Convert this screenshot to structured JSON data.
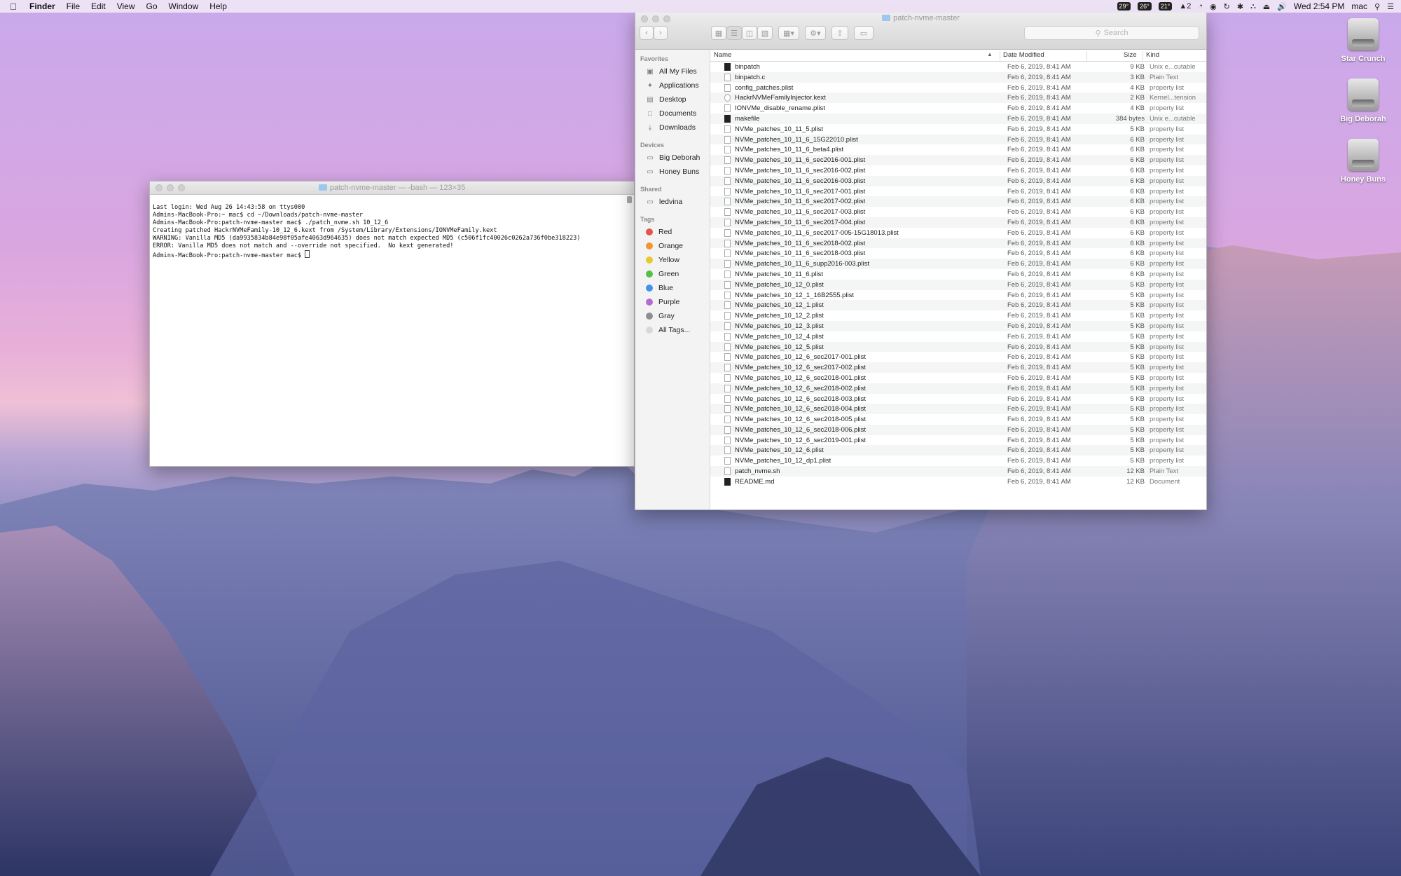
{
  "menubar": {
    "app": "Finder",
    "items": [
      "File",
      "Edit",
      "View",
      "Go",
      "Window",
      "Help"
    ],
    "status": {
      "temp1": "29°",
      "temp2": "26°",
      "temp3": "21°",
      "notif": "2",
      "clock": "Wed 2:54 PM",
      "user": "mac"
    }
  },
  "desktop_icons": [
    {
      "label": "Star Crunch"
    },
    {
      "label": "Big Deborah"
    },
    {
      "label": "Honey Buns"
    }
  ],
  "terminal": {
    "title": "patch-nvme-master — -bash — 123×35",
    "lines": [
      "Last login: Wed Aug 26 14:43:58 on ttys000",
      "Admins-MacBook-Pro:~ mac$ cd ~/Downloads/patch-nvme-master",
      "Admins-MacBook-Pro:patch-nvme-master mac$ ./patch_nvme.sh 10_12_6",
      "Creating patched HackrNVMeFamily-10_12_6.kext from /System/Library/Extensions/IONVMeFamily.kext",
      "WARNING: Vanilla MD5 (da9935834b84e98f05afe4063d964635) does not match expected MD5 (c506f1fc40026c0262a736f0be318223)",
      "ERROR: Vanilla MD5 does not match and --override not specified.  No kext generated!",
      "Admins-MacBook-Pro:patch-nvme-master mac$ "
    ]
  },
  "finder": {
    "title": "patch-nvme-master",
    "search_placeholder": "Search",
    "sidebar": {
      "favorites_header": "Favorites",
      "favorites": [
        "All My Files",
        "Applications",
        "Desktop",
        "Documents",
        "Downloads"
      ],
      "devices_header": "Devices",
      "devices": [
        "Big Deborah",
        "Honey Buns"
      ],
      "shared_header": "Shared",
      "shared": [
        "ledvina"
      ],
      "tags_header": "Tags",
      "tags": [
        {
          "name": "Red",
          "color": "#e5534b"
        },
        {
          "name": "Orange",
          "color": "#f0962f"
        },
        {
          "name": "Yellow",
          "color": "#e9c72e"
        },
        {
          "name": "Green",
          "color": "#55c046"
        },
        {
          "name": "Blue",
          "color": "#3f94e9"
        },
        {
          "name": "Purple",
          "color": "#b66bd3"
        },
        {
          "name": "Gray",
          "color": "#8e8e93"
        },
        {
          "name": "All Tags...",
          "color": "#d8d8d8"
        }
      ]
    },
    "columns": {
      "name": "Name",
      "date": "Date Modified",
      "size": "Size",
      "kind": "Kind"
    },
    "files": [
      {
        "name": "binpatch",
        "date": "Feb 6, 2019, 8:41 AM",
        "size": "9 KB",
        "kind": "Unix e...cutable",
        "type": "exec"
      },
      {
        "name": "binpatch.c",
        "date": "Feb 6, 2019, 8:41 AM",
        "size": "3 KB",
        "kind": "Plain Text",
        "type": "doc"
      },
      {
        "name": "config_patches.plist",
        "date": "Feb 6, 2019, 8:41 AM",
        "size": "4 KB",
        "kind": "property list",
        "type": "doc"
      },
      {
        "name": "HackrNVMeFamilyInjector.kext",
        "date": "Feb 6, 2019, 8:41 AM",
        "size": "2 KB",
        "kind": "Kernel...tension",
        "type": "kext"
      },
      {
        "name": "IONVMe_disable_rename.plist",
        "date": "Feb 6, 2019, 8:41 AM",
        "size": "4 KB",
        "kind": "property list",
        "type": "doc"
      },
      {
        "name": "makefile",
        "date": "Feb 6, 2019, 8:41 AM",
        "size": "384 bytes",
        "kind": "Unix e...cutable",
        "type": "exec"
      },
      {
        "name": "NVMe_patches_10_11_5.plist",
        "date": "Feb 6, 2019, 8:41 AM",
        "size": "5 KB",
        "kind": "property list",
        "type": "doc"
      },
      {
        "name": "NVMe_patches_10_11_6_15G22010.plist",
        "date": "Feb 6, 2019, 8:41 AM",
        "size": "6 KB",
        "kind": "property list",
        "type": "doc"
      },
      {
        "name": "NVMe_patches_10_11_6_beta4.plist",
        "date": "Feb 6, 2019, 8:41 AM",
        "size": "6 KB",
        "kind": "property list",
        "type": "doc"
      },
      {
        "name": "NVMe_patches_10_11_6_sec2016-001.plist",
        "date": "Feb 6, 2019, 8:41 AM",
        "size": "6 KB",
        "kind": "property list",
        "type": "doc"
      },
      {
        "name": "NVMe_patches_10_11_6_sec2016-002.plist",
        "date": "Feb 6, 2019, 8:41 AM",
        "size": "6 KB",
        "kind": "property list",
        "type": "doc"
      },
      {
        "name": "NVMe_patches_10_11_6_sec2016-003.plist",
        "date": "Feb 6, 2019, 8:41 AM",
        "size": "6 KB",
        "kind": "property list",
        "type": "doc"
      },
      {
        "name": "NVMe_patches_10_11_6_sec2017-001.plist",
        "date": "Feb 6, 2019, 8:41 AM",
        "size": "6 KB",
        "kind": "property list",
        "type": "doc"
      },
      {
        "name": "NVMe_patches_10_11_6_sec2017-002.plist",
        "date": "Feb 6, 2019, 8:41 AM",
        "size": "6 KB",
        "kind": "property list",
        "type": "doc"
      },
      {
        "name": "NVMe_patches_10_11_6_sec2017-003.plist",
        "date": "Feb 6, 2019, 8:41 AM",
        "size": "6 KB",
        "kind": "property list",
        "type": "doc"
      },
      {
        "name": "NVMe_patches_10_11_6_sec2017-004.plist",
        "date": "Feb 6, 2019, 8:41 AM",
        "size": "6 KB",
        "kind": "property list",
        "type": "doc"
      },
      {
        "name": "NVMe_patches_10_11_6_sec2017-005-15G18013.plist",
        "date": "Feb 6, 2019, 8:41 AM",
        "size": "6 KB",
        "kind": "property list",
        "type": "doc"
      },
      {
        "name": "NVMe_patches_10_11_6_sec2018-002.plist",
        "date": "Feb 6, 2019, 8:41 AM",
        "size": "6 KB",
        "kind": "property list",
        "type": "doc"
      },
      {
        "name": "NVMe_patches_10_11_6_sec2018-003.plist",
        "date": "Feb 6, 2019, 8:41 AM",
        "size": "6 KB",
        "kind": "property list",
        "type": "doc"
      },
      {
        "name": "NVMe_patches_10_11_6_supp2016-003.plist",
        "date": "Feb 6, 2019, 8:41 AM",
        "size": "6 KB",
        "kind": "property list",
        "type": "doc"
      },
      {
        "name": "NVMe_patches_10_11_6.plist",
        "date": "Feb 6, 2019, 8:41 AM",
        "size": "6 KB",
        "kind": "property list",
        "type": "doc"
      },
      {
        "name": "NVMe_patches_10_12_0.plist",
        "date": "Feb 6, 2019, 8:41 AM",
        "size": "5 KB",
        "kind": "property list",
        "type": "doc"
      },
      {
        "name": "NVMe_patches_10_12_1_16B2555.plist",
        "date": "Feb 6, 2019, 8:41 AM",
        "size": "5 KB",
        "kind": "property list",
        "type": "doc"
      },
      {
        "name": "NVMe_patches_10_12_1.plist",
        "date": "Feb 6, 2019, 8:41 AM",
        "size": "5 KB",
        "kind": "property list",
        "type": "doc"
      },
      {
        "name": "NVMe_patches_10_12_2.plist",
        "date": "Feb 6, 2019, 8:41 AM",
        "size": "5 KB",
        "kind": "property list",
        "type": "doc"
      },
      {
        "name": "NVMe_patches_10_12_3.plist",
        "date": "Feb 6, 2019, 8:41 AM",
        "size": "5 KB",
        "kind": "property list",
        "type": "doc"
      },
      {
        "name": "NVMe_patches_10_12_4.plist",
        "date": "Feb 6, 2019, 8:41 AM",
        "size": "5 KB",
        "kind": "property list",
        "type": "doc"
      },
      {
        "name": "NVMe_patches_10_12_5.plist",
        "date": "Feb 6, 2019, 8:41 AM",
        "size": "5 KB",
        "kind": "property list",
        "type": "doc"
      },
      {
        "name": "NVMe_patches_10_12_6_sec2017-001.plist",
        "date": "Feb 6, 2019, 8:41 AM",
        "size": "5 KB",
        "kind": "property list",
        "type": "doc"
      },
      {
        "name": "NVMe_patches_10_12_6_sec2017-002.plist",
        "date": "Feb 6, 2019, 8:41 AM",
        "size": "5 KB",
        "kind": "property list",
        "type": "doc"
      },
      {
        "name": "NVMe_patches_10_12_6_sec2018-001.plist",
        "date": "Feb 6, 2019, 8:41 AM",
        "size": "5 KB",
        "kind": "property list",
        "type": "doc"
      },
      {
        "name": "NVMe_patches_10_12_6_sec2018-002.plist",
        "date": "Feb 6, 2019, 8:41 AM",
        "size": "5 KB",
        "kind": "property list",
        "type": "doc"
      },
      {
        "name": "NVMe_patches_10_12_6_sec2018-003.plist",
        "date": "Feb 6, 2019, 8:41 AM",
        "size": "5 KB",
        "kind": "property list",
        "type": "doc"
      },
      {
        "name": "NVMe_patches_10_12_6_sec2018-004.plist",
        "date": "Feb 6, 2019, 8:41 AM",
        "size": "5 KB",
        "kind": "property list",
        "type": "doc"
      },
      {
        "name": "NVMe_patches_10_12_6_sec2018-005.plist",
        "date": "Feb 6, 2019, 8:41 AM",
        "size": "5 KB",
        "kind": "property list",
        "type": "doc"
      },
      {
        "name": "NVMe_patches_10_12_6_sec2018-006.plist",
        "date": "Feb 6, 2019, 8:41 AM",
        "size": "5 KB",
        "kind": "property list",
        "type": "doc"
      },
      {
        "name": "NVMe_patches_10_12_6_sec2019-001.plist",
        "date": "Feb 6, 2019, 8:41 AM",
        "size": "5 KB",
        "kind": "property list",
        "type": "doc"
      },
      {
        "name": "NVMe_patches_10_12_6.plist",
        "date": "Feb 6, 2019, 8:41 AM",
        "size": "5 KB",
        "kind": "property list",
        "type": "doc"
      },
      {
        "name": "NVMe_patches_10_12_dp1.plist",
        "date": "Feb 6, 2019, 8:41 AM",
        "size": "5 KB",
        "kind": "property list",
        "type": "doc"
      },
      {
        "name": "patch_nvme.sh",
        "date": "Feb 6, 2019, 8:41 AM",
        "size": "12 KB",
        "kind": "Plain Text",
        "type": "doc"
      },
      {
        "name": "README.md",
        "date": "Feb 6, 2019, 8:41 AM",
        "size": "12 KB",
        "kind": "Document",
        "type": "exec"
      }
    ]
  }
}
